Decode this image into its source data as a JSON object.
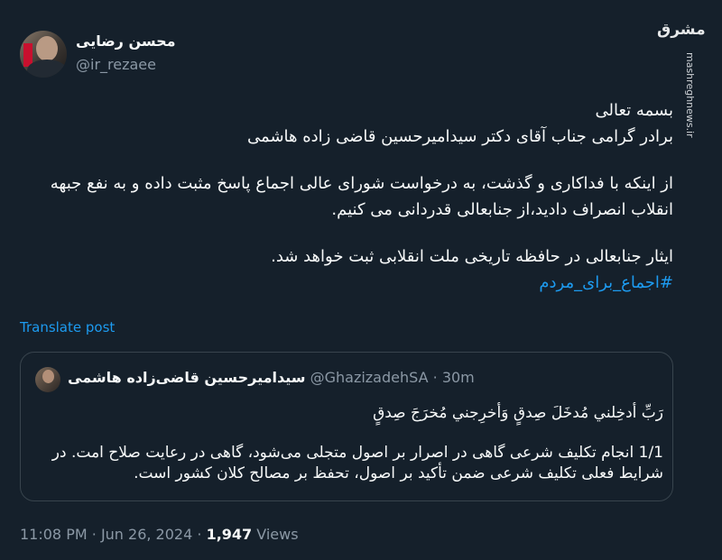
{
  "author": {
    "display_name": "محسن رضایی",
    "handle": "@ir_rezaee",
    "avatar_icon": "person-portrait"
  },
  "watermark": {
    "logo_text": "مشرق",
    "url": "mashreghnews.ir"
  },
  "tweet": {
    "paragraphs": [
      [
        "بسمه تعالی",
        "برادر گرامی جناب آقای دکتر سیدامیرحسین قاضی زاده هاشمی"
      ],
      [
        "از اینکه با فداکاری و گذشت، به درخواست شورای عالی اجماع پاسخ مثبت داده و به نفع جبهه انقلاب انصراف دادید،از جنابعالی قدردانی می کنیم."
      ],
      [
        "ایثار جنابعالی در حافظه تاریخی ملت انقلابی ثبت خواهد شد."
      ]
    ],
    "hashtag": "#اجماع_برای_مردم"
  },
  "translate_label": "Translate post",
  "quoted": {
    "display_name": "سیدامیرحسین قاضی‌زاده هاشمی",
    "handle": "@GhazizadehSA",
    "separator": "·",
    "time": "30m",
    "line1": "رَبِّ أدخِلني مُدخَلَ صِدقٍ وَأخرِجني مُخرَجَ صِدقٍ",
    "body": "1/1 انجام تکلیف شرعی گاهی در اصرار بر اصول متجلی می‌شود، گاهی در رعایت صلاح امت. در شرایط فعلی تکلیف شرعی ضمن تأکید بر اصول، تحفظ بر مصالح کلان کشور است."
  },
  "meta": {
    "time": "11:08 PM",
    "sep1": "·",
    "date": "Jun 26, 2024",
    "sep2": "·",
    "views_count": "1,947",
    "views_label": "Views"
  },
  "colors": {
    "background": "#15202b",
    "text": "#f7f9f9",
    "secondary": "#8b98a5",
    "link": "#1d9bf0",
    "border": "#38444d"
  }
}
